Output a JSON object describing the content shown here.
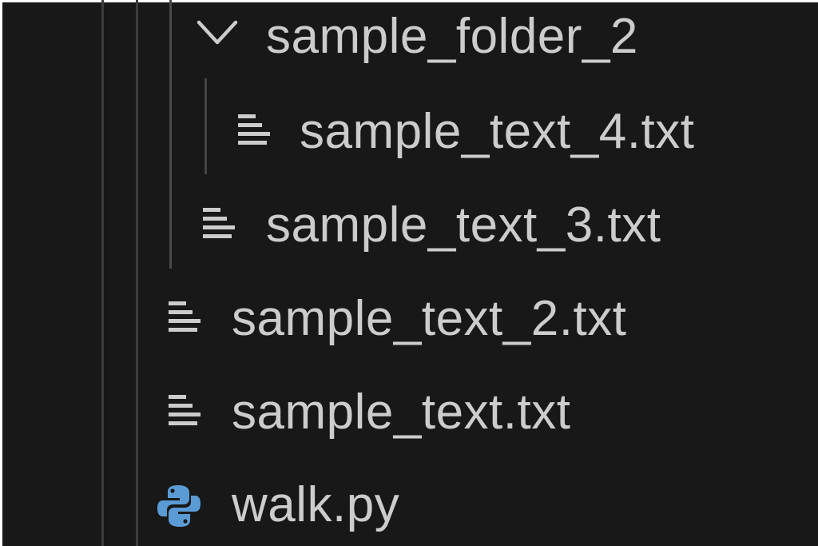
{
  "explorer": {
    "items": [
      {
        "label": "sample_folder_2",
        "icon": "chevron-down-icon",
        "expanded": true
      },
      {
        "label": "sample_text_4.txt",
        "icon": "text-file-icon"
      },
      {
        "label": "sample_text_3.txt",
        "icon": "text-file-icon"
      },
      {
        "label": "sample_text_2.txt",
        "icon": "text-file-icon"
      },
      {
        "label": "sample_text.txt",
        "icon": "text-file-icon"
      },
      {
        "label": "walk.py",
        "icon": "python-icon"
      }
    ]
  },
  "colors": {
    "background": "#181818",
    "text": "#cccccc",
    "icon": "#cccccc",
    "python_blue": "#5b9bd5",
    "indent_guide": "#3c3c3c"
  }
}
